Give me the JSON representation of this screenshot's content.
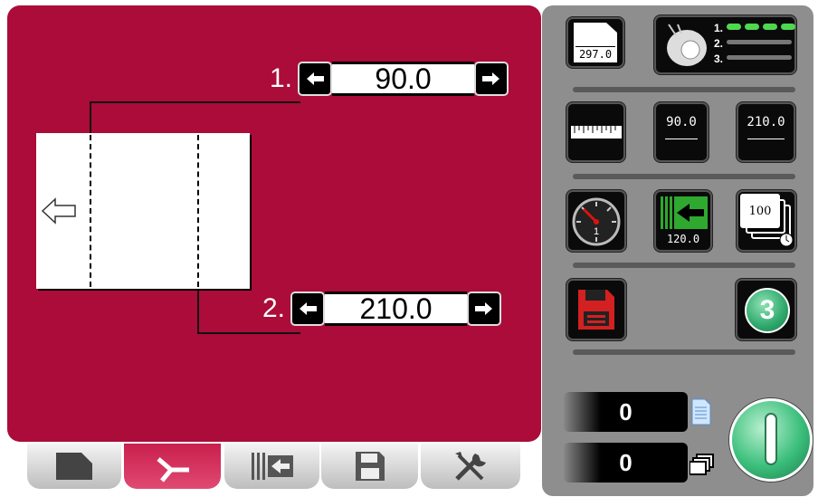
{
  "fold1": {
    "number": "1.",
    "value": "90.0"
  },
  "fold2": {
    "number": "2.",
    "value": "210.0"
  },
  "sheet": {
    "feed_direction_icon": "arrow-left-outline-icon"
  },
  "tabs": [
    {
      "name": "sheet-tab",
      "icon": "sheet-icon",
      "active": false
    },
    {
      "name": "fold-tab",
      "icon": "fold-icon",
      "active": true
    },
    {
      "name": "feed-tab",
      "icon": "feed-icon",
      "active": false
    },
    {
      "name": "save-tab",
      "icon": "floppy-icon",
      "active": false
    },
    {
      "name": "tools-tab",
      "icon": "tools-icon",
      "active": false
    }
  ],
  "side": {
    "paper_length": "297.0",
    "roller_labels": [
      "1.",
      "2.",
      "3."
    ],
    "fold_readout_1": "90.0",
    "fold_readout_2": "210.0",
    "speed_value": "1",
    "stop_value": "120.0",
    "batch_value": "100",
    "program_number": "3",
    "sheet_counter": "0",
    "stack_counter": "0"
  },
  "colors": {
    "main": "#ab0c3a",
    "side": "#8e8e8e",
    "accent_green": "#2ea86c",
    "led_green": "#4fd84f"
  }
}
